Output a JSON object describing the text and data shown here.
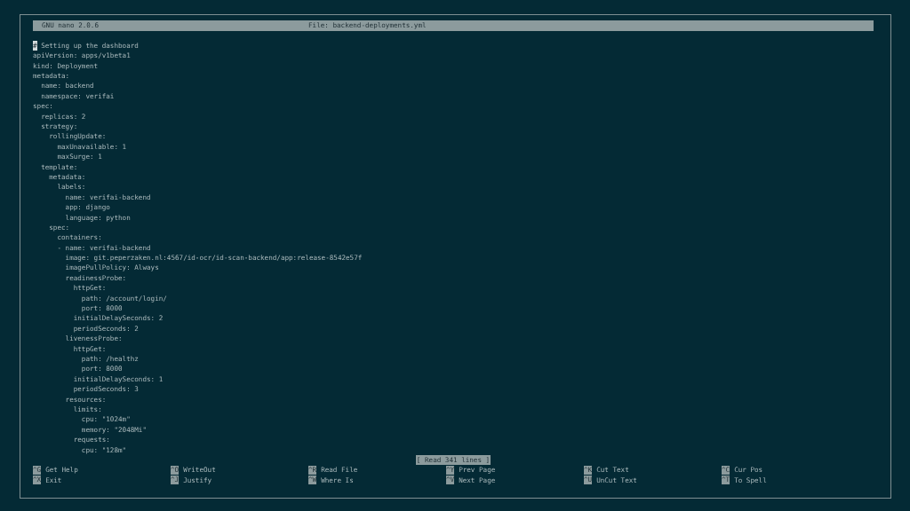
{
  "title_bar": {
    "app": "GNU nano 2.0.6",
    "file": "File: backend-deployments.yml"
  },
  "cursor": {
    "char": "#"
  },
  "lines": [
    " Setting up the dashboard",
    "apiVersion: apps/v1beta1",
    "kind: Deployment",
    "metadata:",
    "  name: backend",
    "  namespace: verifai",
    "spec:",
    "  replicas: 2",
    "  strategy:",
    "    rollingUpdate:",
    "      maxUnavailable: 1",
    "      maxSurge: 1",
    "  template:",
    "    metadata:",
    "      labels:",
    "        name: verifai-backend",
    "        app: django",
    "        language: python",
    "    spec:",
    "      containers:",
    "      - name: verifai-backend",
    "        image: git.peperzaken.nl:4567/id-ocr/id-scan-backend/app:release-8542e57f",
    "        imagePullPolicy: Always",
    "        readinessProbe:",
    "          httpGet:",
    "            path: /account/login/",
    "            port: 8000",
    "          initialDelaySeconds: 2",
    "          periodSeconds: 2",
    "        livenessProbe:",
    "          httpGet:",
    "            path: /healthz",
    "            port: 8000",
    "          initialDelaySeconds: 1",
    "          periodSeconds: 3",
    "        resources:",
    "          limits:",
    "            cpu: \"1024m\"",
    "            memory: \"2048Mi\"",
    "          requests:",
    "            cpu: \"128m\""
  ],
  "status": "[ Read 341 lines ]",
  "shortcuts": [
    {
      "key": "^G",
      "label": "Get Help"
    },
    {
      "key": "^O",
      "label": "WriteOut"
    },
    {
      "key": "^R",
      "label": "Read File"
    },
    {
      "key": "^Y",
      "label": "Prev Page"
    },
    {
      "key": "^K",
      "label": "Cut Text"
    },
    {
      "key": "^C",
      "label": "Cur Pos"
    },
    {
      "key": "^X",
      "label": "Exit"
    },
    {
      "key": "^J",
      "label": "Justify"
    },
    {
      "key": "^W",
      "label": "Where Is"
    },
    {
      "key": "^V",
      "label": "Next Page"
    },
    {
      "key": "^U",
      "label": "UnCut Text"
    },
    {
      "key": "^T",
      "label": "To Spell"
    }
  ]
}
